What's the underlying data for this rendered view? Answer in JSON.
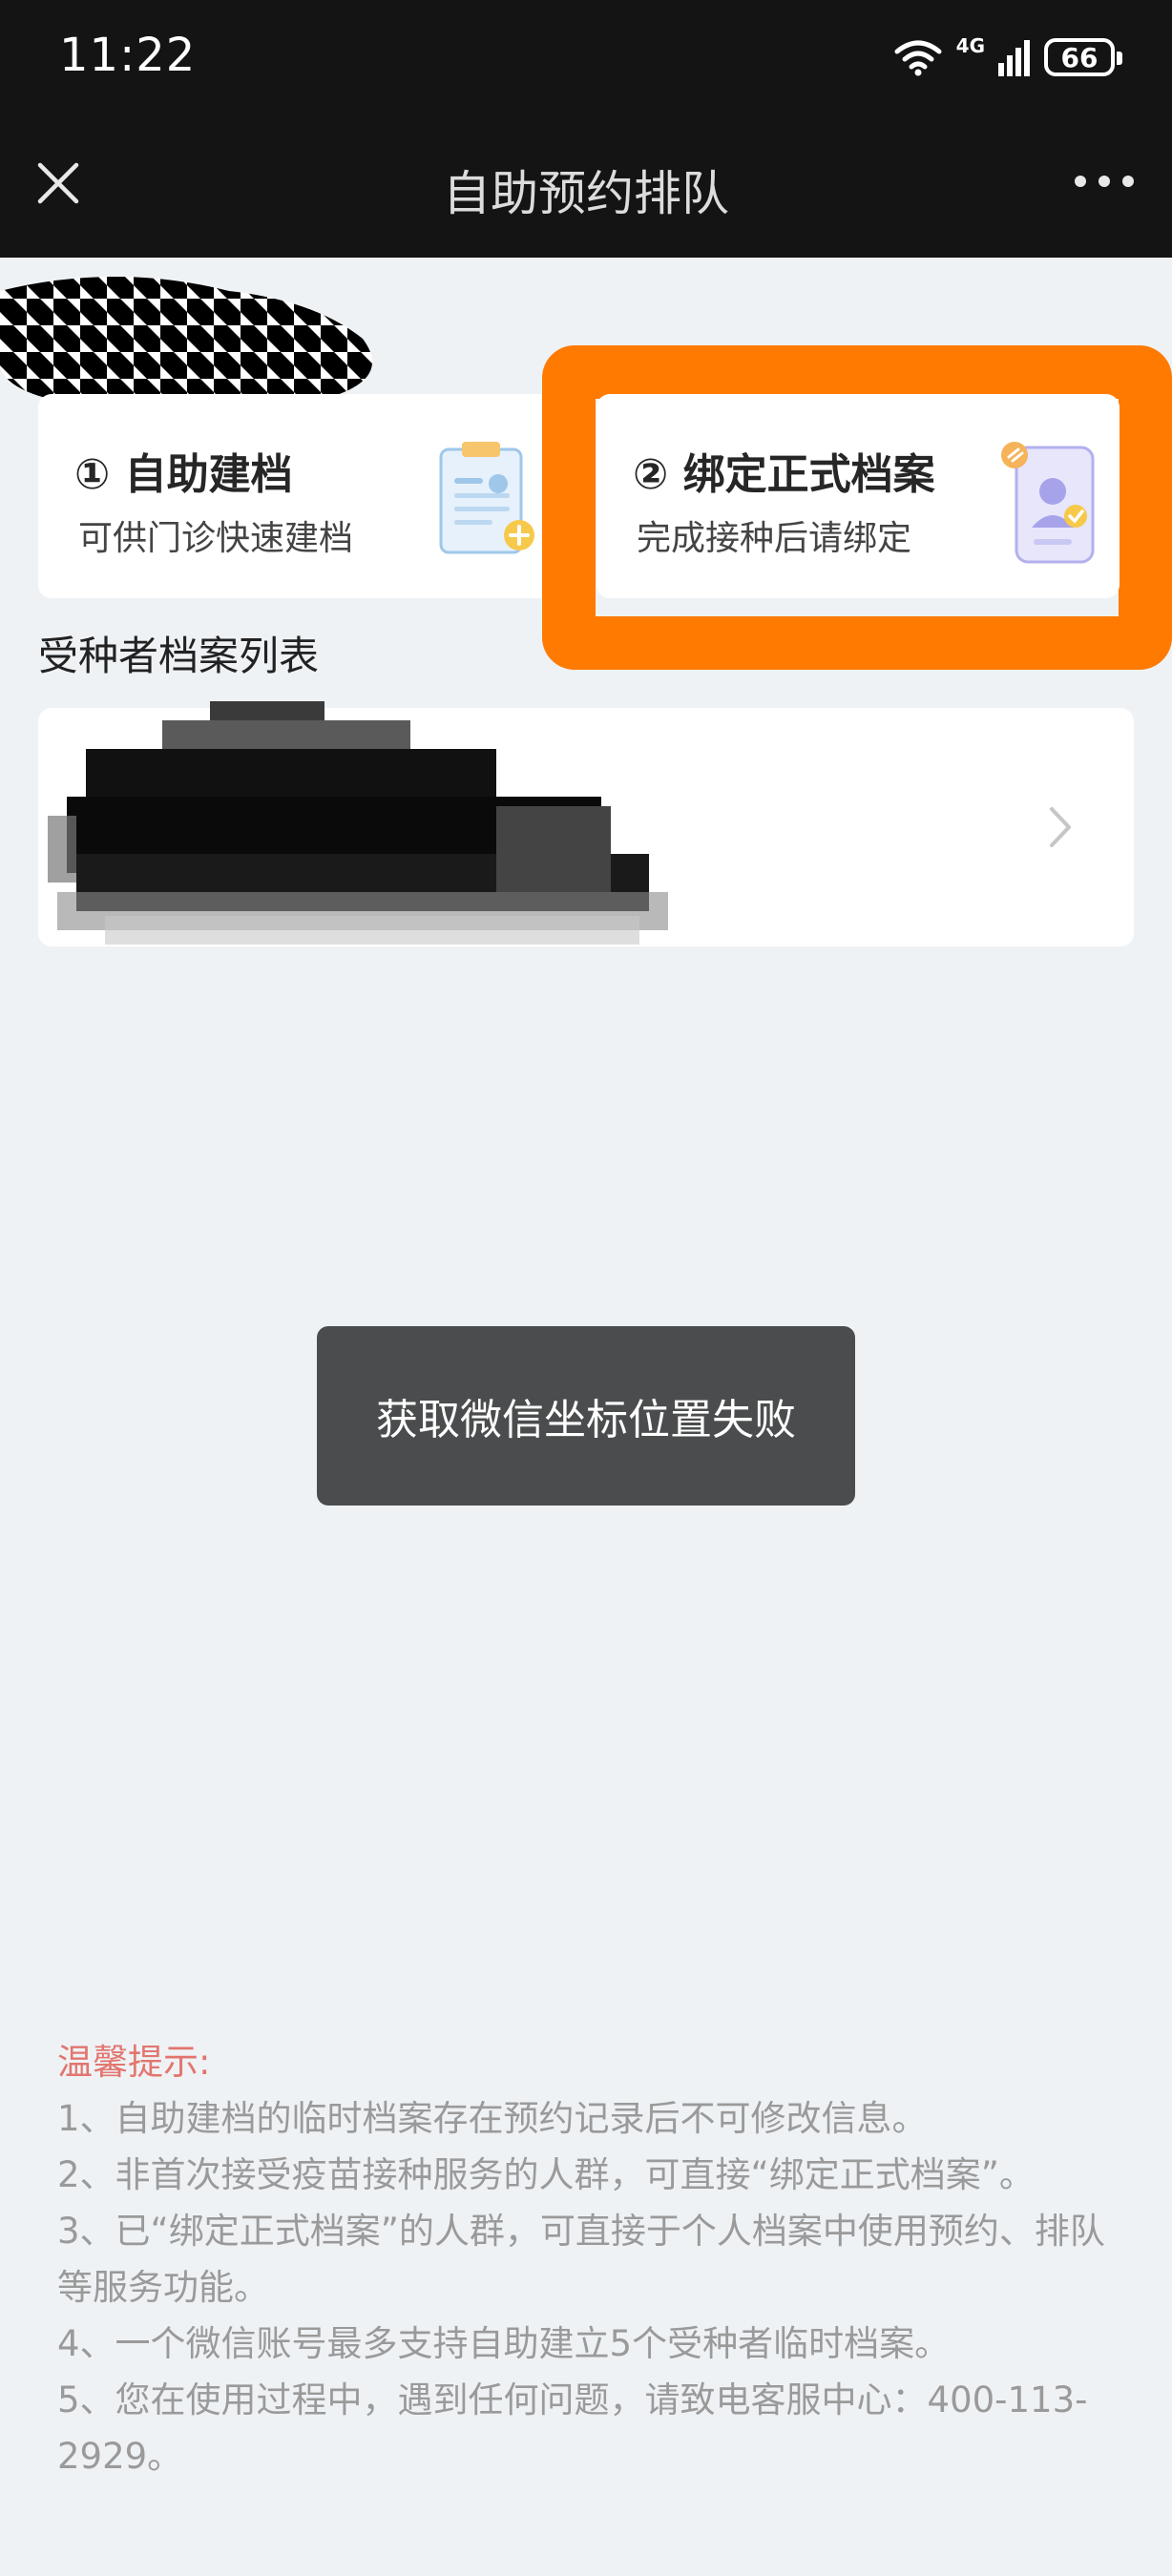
{
  "status_bar": {
    "time": "11:22",
    "network": "4G",
    "battery": "66",
    "icons": [
      "wifi-icon",
      "signal-icon",
      "battery-icon"
    ]
  },
  "nav": {
    "title": "自助预约排队",
    "close_icon": "close-icon",
    "more_icon": "more-icon"
  },
  "actions": [
    {
      "title": "① 自助建档",
      "subtitle": "可供门诊快速建档",
      "icon": "clipboard-add-icon"
    },
    {
      "title": "② 绑定正式档案",
      "subtitle": "完成接种后请绑定",
      "icon": "phone-profile-check-icon"
    }
  ],
  "records_section": {
    "title": "受种者档案列表",
    "chevron_icon": "chevron-right-icon"
  },
  "toast": "获取微信坐标位置失败",
  "tips": {
    "title": "温馨提示:",
    "items": [
      "1、自助建档的临时档案存在预约记录后不可修改信息。",
      "2、非首次接受疫苗接种服务的人群，可直接“绑定正式档案”。",
      "3、已“绑定正式档案”的人群，可直接于个人档案中使用预约、排队等服务功能。",
      "4、一个微信账号最多支持自助建立5个受种者临时档案。",
      "5、您在使用过程中，遇到任何问题，请致电客服中心：400-113-2929。"
    ]
  },
  "colors": {
    "highlight": "#ff7a00",
    "tips_title": "#e2766f",
    "toast_bg": "#4b4c4d"
  }
}
